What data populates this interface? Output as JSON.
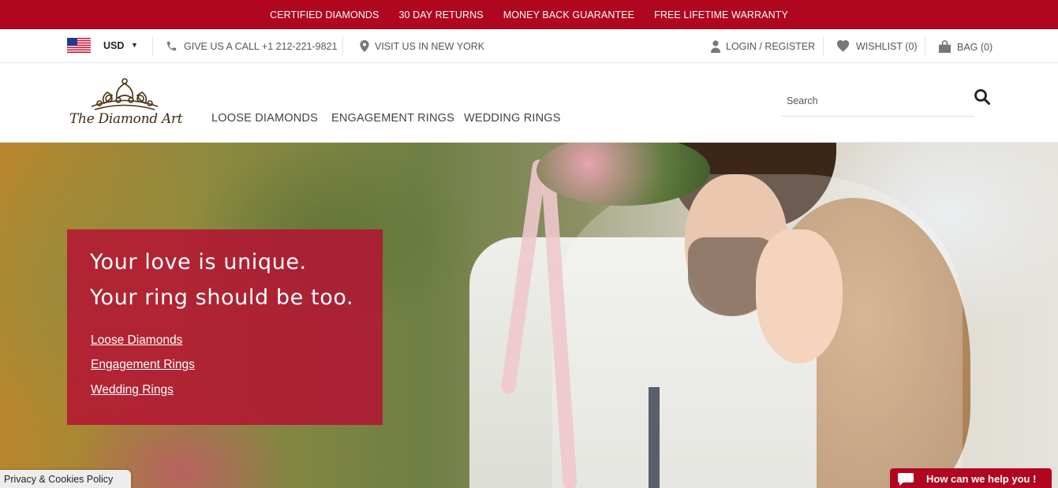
{
  "promo_bar": {
    "items": [
      "CERTIFIED DIAMONDS",
      "30 DAY RETURNS",
      "MONEY BACK GUARANTEE",
      "FREE LIFETIME WARRANTY"
    ],
    "background": "#b0061f"
  },
  "utility_bar": {
    "currency": "USD",
    "phone": "GIVE US A CALL +1 212-221-9821",
    "location": "VISIT US IN NEW YORK",
    "login": "LOGIN / REGISTER",
    "wishlist": "WISHLIST (0)",
    "bag": "BAG (0)"
  },
  "header": {
    "logo_text": "The Diamond Art",
    "nav": [
      "LOOSE DIAMONDS",
      "ENGAGEMENT RINGS",
      "WEDDING RINGS"
    ],
    "search_placeholder": "Search"
  },
  "hero": {
    "headline_1": "Your love is unique.",
    "headline_2": "Your ring should be too.",
    "links": [
      "Loose Diamonds",
      "Engagement Rings",
      "Wedding Rings"
    ],
    "box_color": "#b60e32"
  },
  "footer_widgets": {
    "privacy": "Privacy & Cookies Policy",
    "chat": "How can we help you !"
  },
  "icons": [
    "us-flag-icon",
    "phone-icon",
    "map-pin-icon",
    "user-icon",
    "heart-icon",
    "bag-icon",
    "search-icon",
    "chat-bubble-icon"
  ]
}
